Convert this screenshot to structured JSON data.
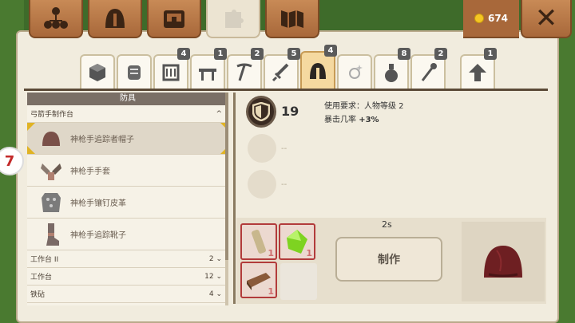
{
  "coins": "674",
  "top_tabs": [
    {
      "icon": "sitemap-icon"
    },
    {
      "icon": "helmet-icon"
    },
    {
      "icon": "chest-icon"
    },
    {
      "icon": "puzzle-icon",
      "active": true
    },
    {
      "icon": "map-icon"
    }
  ],
  "categories": [
    {
      "icon": "cube-icon",
      "badge": ""
    },
    {
      "icon": "scroll-icon",
      "badge": ""
    },
    {
      "icon": "loom-icon",
      "badge": "4"
    },
    {
      "icon": "table-icon",
      "badge": "1"
    },
    {
      "icon": "pickaxe-icon",
      "badge": "2"
    },
    {
      "icon": "sword-icon",
      "badge": "5"
    },
    {
      "icon": "helmet-icon",
      "badge": "4",
      "active": true
    },
    {
      "icon": "sparkle-icon",
      "badge": ""
    },
    {
      "icon": "potion-icon",
      "badge": "8"
    },
    {
      "icon": "staff-icon",
      "badge": "2"
    },
    {
      "icon": "arrow-up-icon",
      "badge": "1"
    }
  ],
  "left_panel": {
    "title": "防具",
    "group_open": {
      "label": "弓箭手制作台",
      "chevron": "^"
    },
    "items": [
      {
        "label": "神枪手追踪者帽子",
        "selected": true
      },
      {
        "label": "神枪手手套"
      },
      {
        "label": "神枪手镶钉皮革"
      },
      {
        "label": "神枪手追踪靴子"
      }
    ],
    "groups": [
      {
        "label": "工作台 II",
        "count": "2"
      },
      {
        "label": "工作台",
        "count": "12"
      },
      {
        "label": "铁砧",
        "count": "4"
      }
    ]
  },
  "detail": {
    "defense": "19",
    "requirement": "使用要求：人物等级 2",
    "crit_label": "暴击几率",
    "crit_value": "+3%",
    "empty_dash": "--",
    "time": "2s",
    "craft_label": "制作",
    "materials": [
      {
        "icon": "wood-icon",
        "count": "1"
      },
      {
        "icon": "green-gem-icon",
        "count": "1"
      },
      {
        "icon": "leather-icon",
        "count": "1"
      }
    ]
  },
  "side_badge": "7",
  "colors": {
    "accent": "#a8683a",
    "selected_tab": "#f5d9a0",
    "missing": "#b23b3b"
  }
}
